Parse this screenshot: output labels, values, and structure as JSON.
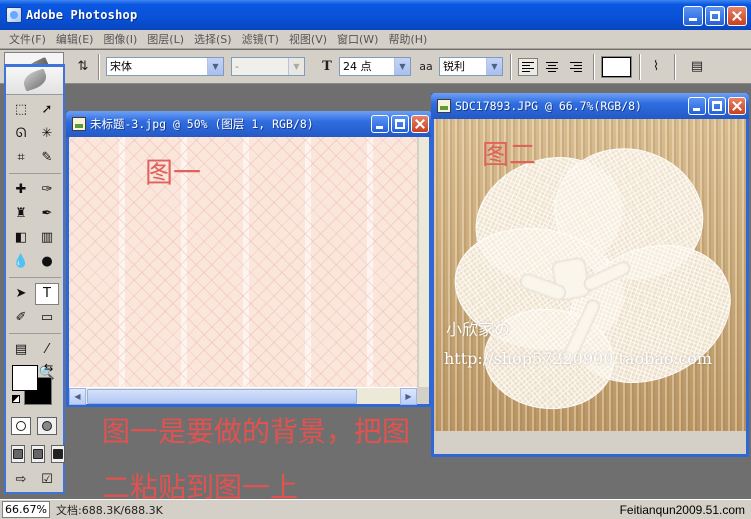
{
  "window": {
    "title": "Adobe Photoshop",
    "minimize_label": "",
    "maximize_label": "",
    "close_label": ""
  },
  "menu": [
    {
      "label": "文件(F)"
    },
    {
      "label": "编辑(E)"
    },
    {
      "label": "图像(I)"
    },
    {
      "label": "图层(L)"
    },
    {
      "label": "选择(S)"
    },
    {
      "label": "滤镜(T)"
    },
    {
      "label": "视图(V)"
    },
    {
      "label": "窗口(W)"
    },
    {
      "label": "帮助(H)"
    }
  ],
  "options": {
    "font_family": "宋体",
    "font_style": "-",
    "font_size": "24 点",
    "antialias_icon": "aa",
    "antialias": "锐利",
    "text_color": "#ffffff"
  },
  "toolbox": {
    "tools": [
      "marquee-icon",
      "move-icon",
      "lasso-icon",
      "magic-wand-icon",
      "crop-icon",
      "slice-icon",
      "healing-brush-icon",
      "brush-icon",
      "clone-stamp-icon",
      "history-brush-icon",
      "eraser-icon",
      "gradient-icon",
      "blur-icon",
      "dodge-icon",
      "path-selection-icon",
      "type-icon",
      "pen-icon",
      "shape-icon",
      "notes-icon",
      "eyedropper-icon",
      "hand-icon",
      "zoom-icon"
    ],
    "foreground_color": "#ffffff",
    "background_color": "#000000"
  },
  "doc1": {
    "title": "未标题-3.jpg @ 50% (图层 1, RGB/8)",
    "label": "图一"
  },
  "doc2": {
    "title": "SDC17893.JPG @ 66.7%(RGB/8)",
    "label": "图二",
    "watermark_name": "小欣家の",
    "watermark_url": "http://shop57220900.taobao.com"
  },
  "notes": {
    "line1": "图一是要做的背景，把图",
    "line2": "二粘贴到图一上"
  },
  "status": {
    "zoom": "66.67%",
    "doc_size": "文档:688.3K/688.3K",
    "site": "Feitianqun2009.51.com"
  }
}
